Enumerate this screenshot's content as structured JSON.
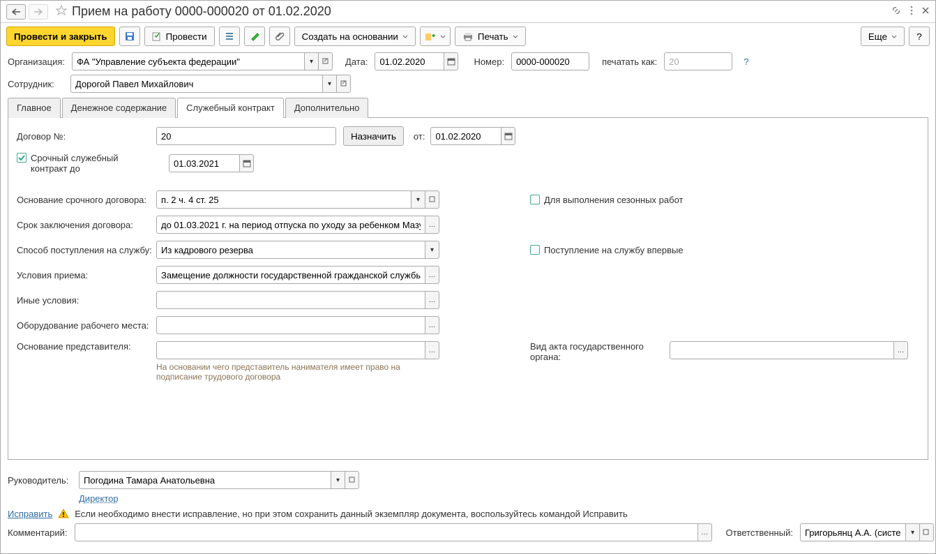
{
  "titlebar": {
    "title": "Прием на работу 0000-000020 от 01.02.2020"
  },
  "toolbar": {
    "post_close": "Провести и закрыть",
    "post": "Провести",
    "create_based": "Создать на основании",
    "print": "Печать",
    "more": "Еще"
  },
  "header": {
    "org_label": "Организация:",
    "org_value": "ФА \"Управление субъекта федерации\"",
    "emp_label": "Сотрудник:",
    "emp_value": "Дорогой Павел Михайлович",
    "date_label": "Дата:",
    "date_value": "01.02.2020",
    "number_label": "Номер:",
    "number_value": "0000-000020",
    "print_as_label": "печатать как:",
    "print_as_value": "20"
  },
  "tabs": {
    "main": "Главное",
    "salary": "Денежное содержание",
    "contract": "Служебный контракт",
    "extra": "Дополнительно"
  },
  "contract": {
    "number_label": "Договор №:",
    "number_value": "20",
    "assign_btn": "Назначить",
    "from_label": "от:",
    "from_value": "01.02.2020",
    "urgent_label": "Срочный служебный контракт до",
    "urgent_value": "01.03.2021",
    "basis_label": "Основание срочного договора:",
    "basis_value": "п. 2 ч. 4 ст. 25",
    "seasonal_label": "Для выполнения сезонных работ",
    "term_label": "Срок заключения договора:",
    "term_value": "до 01.03.2021 г. на период отпуска по уходу за ребенком Мазу",
    "method_label": "Способ поступления на службу:",
    "method_value": "Из кадрового резерва",
    "first_time_label": "Поступление на службу впервые",
    "conditions_label": "Условия приема:",
    "conditions_value": "Замещение должности государственной гражданской службы",
    "other_label": "Иные условия:",
    "equipment_label": "Оборудование рабочего места:",
    "rep_basis_label": "Основание представителя:",
    "rep_basis_hint": "На основании чего представитель нанимателя имеет право на подписание трудового договора",
    "act_type_label": "Вид акта государственного органа:"
  },
  "footer": {
    "manager_label": "Руководитель:",
    "manager_value": "Погодина Тамара Анатольевна",
    "manager_position": "Директор",
    "fix_link": "Исправить",
    "fix_hint": "Если необходимо внести исправление, но при этом сохранить данный экземпляр документа, воспользуйтесь командой Исправить",
    "comment_label": "Комментарий:",
    "responsible_label": "Ответственный:",
    "responsible_value": "Григорьянц А.А. (системн"
  }
}
